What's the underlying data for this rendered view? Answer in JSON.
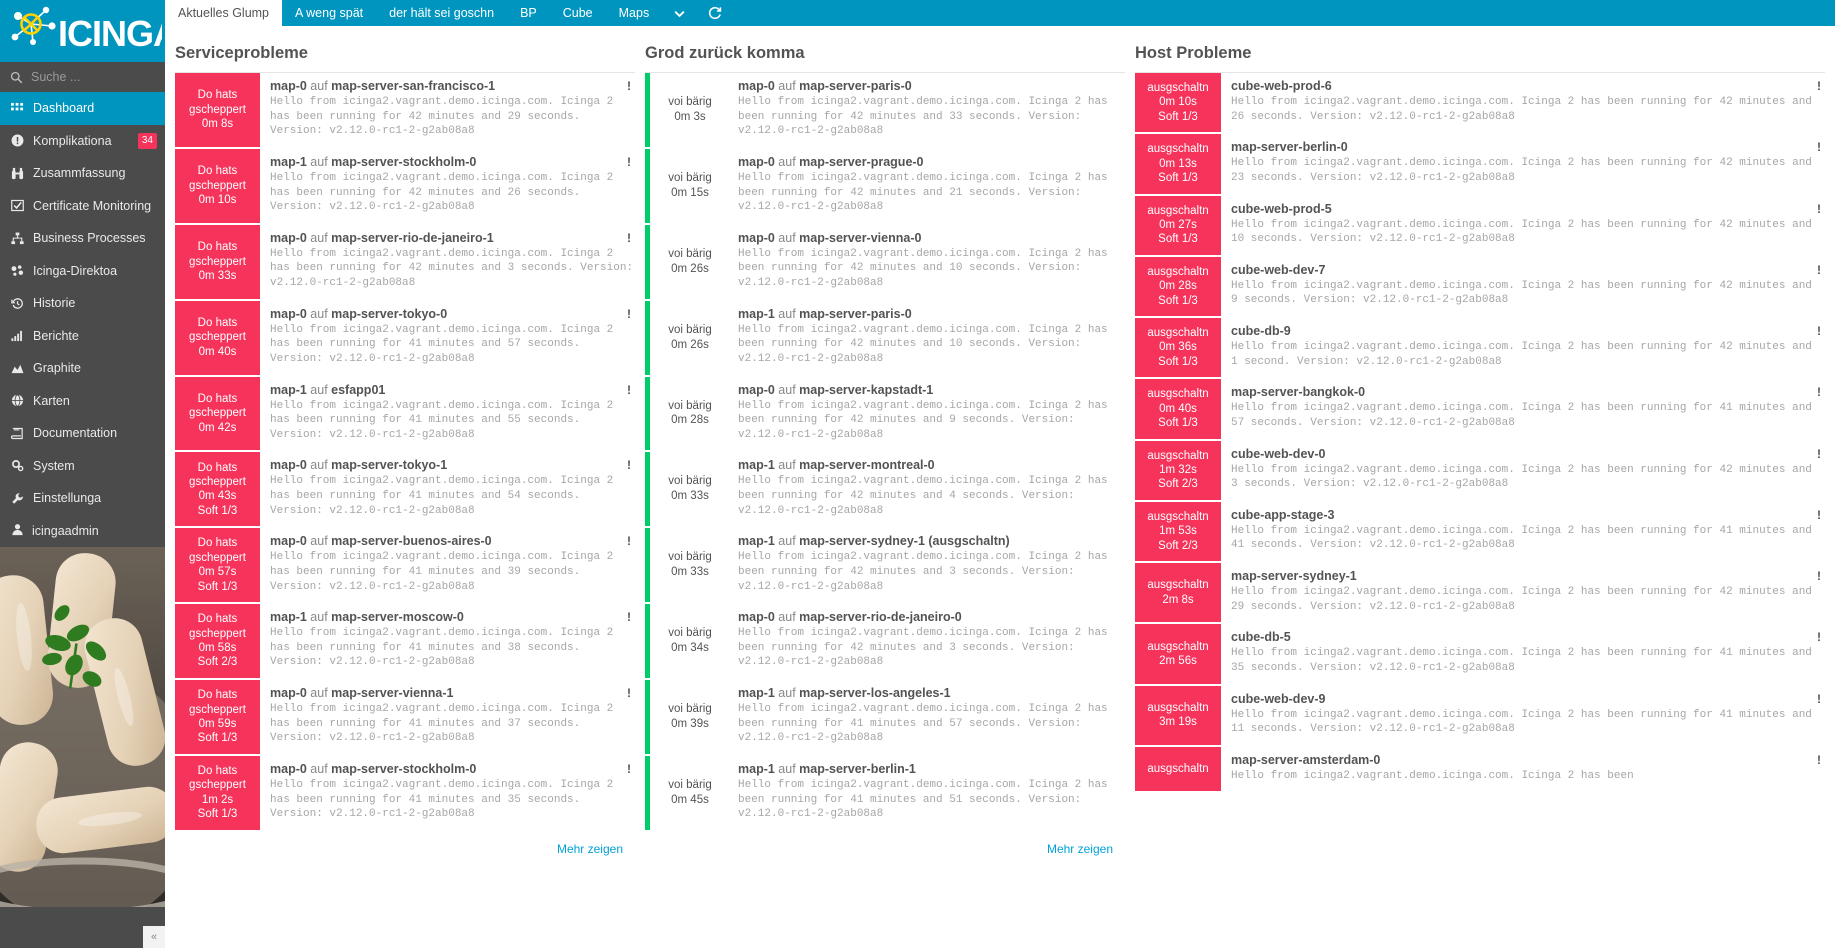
{
  "brand": {
    "name": "ICINGA",
    "logo_icon": "icinga-pretzel-logo"
  },
  "colors": {
    "accent": "#0095bf",
    "critical": "#f5335b",
    "ok": "#00cc6a",
    "link": "#00a2d8",
    "sidebar": "#4b4b4b"
  },
  "search": {
    "placeholder": "Suche ...",
    "value": "",
    "icon": "search-icon"
  },
  "sidebar": {
    "items": [
      {
        "label": "Dashboard",
        "icon": "grid-icon",
        "active": true,
        "badge": ""
      },
      {
        "label": "Komplikationa",
        "icon": "exclamation-circle-icon",
        "active": false,
        "badge": "34"
      },
      {
        "label": "Zusammfassung",
        "icon": "binoculars-icon",
        "active": false,
        "badge": ""
      },
      {
        "label": "Certificate Monitoring",
        "icon": "certificate-check-icon",
        "active": false,
        "badge": ""
      },
      {
        "label": "Business Processes",
        "icon": "sitemap-icon",
        "active": false,
        "badge": ""
      },
      {
        "label": "Icinga-Direktoa",
        "icon": "cloud-nodes-icon",
        "active": false,
        "badge": ""
      },
      {
        "label": "Historie",
        "icon": "history-clock-icon",
        "active": false,
        "badge": ""
      },
      {
        "label": "Berichte",
        "icon": "bar-chart-icon",
        "active": false,
        "badge": ""
      },
      {
        "label": "Graphite",
        "icon": "area-chart-icon",
        "active": false,
        "badge": ""
      },
      {
        "label": "Karten",
        "icon": "globe-icon",
        "active": false,
        "badge": ""
      },
      {
        "label": "Documentation",
        "icon": "book-icon",
        "active": false,
        "badge": ""
      },
      {
        "label": "System",
        "icon": "cogs-icon",
        "active": false,
        "badge": ""
      },
      {
        "label": "Einstellunga",
        "icon": "wrench-icon",
        "active": false,
        "badge": ""
      }
    ],
    "user": {
      "label": "icingaadmin",
      "icon": "user-icon"
    },
    "collapse": {
      "icon": "chevron-left-icon",
      "label": "«"
    }
  },
  "tabs": [
    {
      "label": "Aktuelles Glump",
      "active": true
    },
    {
      "label": "A weng spät",
      "active": false
    },
    {
      "label": "der hält sei goschn",
      "active": false
    },
    {
      "label": "BP",
      "active": false
    },
    {
      "label": "Cube",
      "active": false
    },
    {
      "label": "Maps",
      "active": false
    }
  ],
  "tab_icons": [
    {
      "name": "chevron-down-icon",
      "glyph": "⌄"
    },
    {
      "name": "refresh-icon",
      "glyph": "⟳"
    }
  ],
  "columns": {
    "service_problems": {
      "title": "Serviceprobleme",
      "more_label": "Mehr zeigen",
      "rows": [
        {
          "state": "Do hats gscheppert",
          "duration": "0m 8s",
          "attempt": "",
          "service": "map-0",
          "conj": "auf",
          "host": "map-server-san-francisco-1",
          "message": "Hello from icinga2.vagrant.demo.icinga.com. Icinga 2 has been running for 42 minutes and 29 seconds. Version: v2.12.0-rc1-2-g2ab08a8",
          "icon": "exclamation-icon"
        },
        {
          "state": "Do hats gscheppert",
          "duration": "0m 10s",
          "attempt": "",
          "service": "map-1",
          "conj": "auf",
          "host": "map-server-stockholm-0",
          "message": "Hello from icinga2.vagrant.demo.icinga.com. Icinga 2 has been running for 42 minutes and 26 seconds. Version: v2.12.0-rc1-2-g2ab08a8",
          "icon": "exclamation-icon"
        },
        {
          "state": "Do hats gscheppert",
          "duration": "0m 33s",
          "attempt": "",
          "service": "map-0",
          "conj": "auf",
          "host": "map-server-rio-de-janeiro-1",
          "message": "Hello from icinga2.vagrant.demo.icinga.com. Icinga 2 has been running for 42 minutes and 3 seconds. Version: v2.12.0-rc1-2-g2ab08a8",
          "icon": "exclamation-icon"
        },
        {
          "state": "Do hats gscheppert",
          "duration": "0m 40s",
          "attempt": "",
          "service": "map-0",
          "conj": "auf",
          "host": "map-server-tokyo-0",
          "message": "Hello from icinga2.vagrant.demo.icinga.com. Icinga 2 has been running for 41 minutes and 57 seconds. Version: v2.12.0-rc1-2-g2ab08a8",
          "icon": "exclamation-icon"
        },
        {
          "state": "Do hats gscheppert",
          "duration": "0m 42s",
          "attempt": "",
          "service": "map-1",
          "conj": "auf",
          "host": "esfapp01",
          "message": "Hello from icinga2.vagrant.demo.icinga.com. Icinga 2 has been running for 41 minutes and 55 seconds. Version: v2.12.0-rc1-2-g2ab08a8",
          "icon": "exclamation-icon"
        },
        {
          "state": "Do hats gscheppert",
          "duration": "0m 43s",
          "attempt": "Soft 1/3",
          "service": "map-0",
          "conj": "auf",
          "host": "map-server-tokyo-1",
          "message": "Hello from icinga2.vagrant.demo.icinga.com. Icinga 2 has been running for 41 minutes and 54 seconds. Version: v2.12.0-rc1-2-g2ab08a8",
          "icon": "exclamation-icon"
        },
        {
          "state": "Do hats gscheppert",
          "duration": "0m 57s",
          "attempt": "Soft 1/3",
          "service": "map-0",
          "conj": "auf",
          "host": "map-server-buenos-aires-0",
          "message": "Hello from icinga2.vagrant.demo.icinga.com. Icinga 2 has been running for 41 minutes and 39 seconds. Version: v2.12.0-rc1-2-g2ab08a8",
          "icon": "exclamation-icon"
        },
        {
          "state": "Do hats gscheppert",
          "duration": "0m 58s",
          "attempt": "Soft 2/3",
          "service": "map-1",
          "conj": "auf",
          "host": "map-server-moscow-0",
          "message": "Hello from icinga2.vagrant.demo.icinga.com. Icinga 2 has been running for 41 minutes and 38 seconds. Version: v2.12.0-rc1-2-g2ab08a8",
          "icon": "exclamation-icon"
        },
        {
          "state": "Do hats gscheppert",
          "duration": "0m 59s",
          "attempt": "Soft 1/3",
          "service": "map-0",
          "conj": "auf",
          "host": "map-server-vienna-1",
          "message": "Hello from icinga2.vagrant.demo.icinga.com. Icinga 2 has been running for 41 minutes and 37 seconds. Version: v2.12.0-rc1-2-g2ab08a8",
          "icon": "exclamation-icon"
        },
        {
          "state": "Do hats gscheppert",
          "duration": "1m 2s",
          "attempt": "Soft 1/3",
          "service": "map-0",
          "conj": "auf",
          "host": "map-server-stockholm-0",
          "message": "Hello from icinga2.vagrant.demo.icinga.com. Icinga 2 has been running for 41 minutes and 35 seconds. Version: v2.12.0-rc1-2-g2ab08a8",
          "icon": "exclamation-icon"
        }
      ]
    },
    "recent_recoveries": {
      "title": "Grod zurück komma",
      "more_label": "Mehr zeigen",
      "rows": [
        {
          "state": "voi bärig",
          "duration": "0m 3s",
          "service": "map-0",
          "conj": "auf",
          "host": "map-server-paris-0",
          "message": "Hello from icinga2.vagrant.demo.icinga.com. Icinga 2 has been running for 42 minutes and 33 seconds. Version: v2.12.0-rc1-2-g2ab08a8"
        },
        {
          "state": "voi bärig",
          "duration": "0m 15s",
          "service": "map-0",
          "conj": "auf",
          "host": "map-server-prague-0",
          "message": "Hello from icinga2.vagrant.demo.icinga.com. Icinga 2 has been running for 42 minutes and 21 seconds. Version: v2.12.0-rc1-2-g2ab08a8"
        },
        {
          "state": "voi bärig",
          "duration": "0m 26s",
          "service": "map-0",
          "conj": "auf",
          "host": "map-server-vienna-0",
          "message": "Hello from icinga2.vagrant.demo.icinga.com. Icinga 2 has been running for 42 minutes and 10 seconds. Version: v2.12.0-rc1-2-g2ab08a8"
        },
        {
          "state": "voi bärig",
          "duration": "0m 26s",
          "service": "map-1",
          "conj": "auf",
          "host": "map-server-paris-0",
          "message": "Hello from icinga2.vagrant.demo.icinga.com. Icinga 2 has been running for 42 minutes and 10 seconds. Version: v2.12.0-rc1-2-g2ab08a8"
        },
        {
          "state": "voi bärig",
          "duration": "0m 28s",
          "service": "map-0",
          "conj": "auf",
          "host": "map-server-kapstadt-1",
          "message": "Hello from icinga2.vagrant.demo.icinga.com. Icinga 2 has been running for 42 minutes and 9 seconds. Version: v2.12.0-rc1-2-g2ab08a8"
        },
        {
          "state": "voi bärig",
          "duration": "0m 33s",
          "service": "map-1",
          "conj": "auf",
          "host": "map-server-montreal-0",
          "message": "Hello from icinga2.vagrant.demo.icinga.com. Icinga 2 has been running for 42 minutes and 4 seconds. Version: v2.12.0-rc1-2-g2ab08a8"
        },
        {
          "state": "voi bärig",
          "duration": "0m 33s",
          "service": "map-1",
          "conj": "auf",
          "host": "map-server-sydney-1 (ausgschaltn)",
          "message": "Hello from icinga2.vagrant.demo.icinga.com. Icinga 2 has been running for 42 minutes and 3 seconds. Version: v2.12.0-rc1-2-g2ab08a8"
        },
        {
          "state": "voi bärig",
          "duration": "0m 34s",
          "service": "map-0",
          "conj": "auf",
          "host": "map-server-rio-de-janeiro-0",
          "message": "Hello from icinga2.vagrant.demo.icinga.com. Icinga 2 has been running for 42 minutes and 3 seconds. Version: v2.12.0-rc1-2-g2ab08a8"
        },
        {
          "state": "voi bärig",
          "duration": "0m 39s",
          "service": "map-1",
          "conj": "auf",
          "host": "map-server-los-angeles-1",
          "message": "Hello from icinga2.vagrant.demo.icinga.com. Icinga 2 has been running for 41 minutes and 57 seconds. Version: v2.12.0-rc1-2-g2ab08a8"
        },
        {
          "state": "voi bärig",
          "duration": "0m 45s",
          "service": "map-1",
          "conj": "auf",
          "host": "map-server-berlin-1",
          "message": "Hello from icinga2.vagrant.demo.icinga.com. Icinga 2 has been running for 41 minutes and 51 seconds. Version: v2.12.0-rc1-2-g2ab08a8"
        }
      ]
    },
    "host_problems": {
      "title": "Host Probleme",
      "rows": [
        {
          "state": "ausgschaltn",
          "duration": "0m 10s",
          "attempt": "Soft 1/3",
          "host": "cube-web-prod-6",
          "message": "Hello from icinga2.vagrant.demo.icinga.com. Icinga 2 has been running for 42 minutes and 26 seconds. Version: v2.12.0-rc1-2-g2ab08a8",
          "icon": "exclamation-icon"
        },
        {
          "state": "ausgschaltn",
          "duration": "0m 13s",
          "attempt": "Soft 1/3",
          "host": "map-server-berlin-0",
          "message": "Hello from icinga2.vagrant.demo.icinga.com. Icinga 2 has been running for 42 minutes and 23 seconds. Version: v2.12.0-rc1-2-g2ab08a8",
          "icon": "exclamation-icon"
        },
        {
          "state": "ausgschaltn",
          "duration": "0m 27s",
          "attempt": "Soft 1/3",
          "host": "cube-web-prod-5",
          "message": "Hello from icinga2.vagrant.demo.icinga.com. Icinga 2 has been running for 42 minutes and 10 seconds. Version: v2.12.0-rc1-2-g2ab08a8",
          "icon": "exclamation-icon"
        },
        {
          "state": "ausgschaltn",
          "duration": "0m 28s",
          "attempt": "Soft 1/3",
          "host": "cube-web-dev-7",
          "message": "Hello from icinga2.vagrant.demo.icinga.com. Icinga 2 has been running for 42 minutes and 9 seconds. Version: v2.12.0-rc1-2-g2ab08a8",
          "icon": "exclamation-icon"
        },
        {
          "state": "ausgschaltn",
          "duration": "0m 36s",
          "attempt": "Soft 1/3",
          "host": "cube-db-9",
          "message": "Hello from icinga2.vagrant.demo.icinga.com. Icinga 2 has been running for 42 minutes and 1 second. Version: v2.12.0-rc1-2-g2ab08a8",
          "icon": "exclamation-icon"
        },
        {
          "state": "ausgschaltn",
          "duration": "0m 40s",
          "attempt": "Soft 1/3",
          "host": "map-server-bangkok-0",
          "message": "Hello from icinga2.vagrant.demo.icinga.com. Icinga 2 has been running for 41 minutes and 57 seconds. Version: v2.12.0-rc1-2-g2ab08a8",
          "icon": "exclamation-icon"
        },
        {
          "state": "ausgschaltn",
          "duration": "1m 32s",
          "attempt": "Soft 2/3",
          "host": "cube-web-dev-0",
          "message": "Hello from icinga2.vagrant.demo.icinga.com. Icinga 2 has been running for 42 minutes and 3 seconds. Version: v2.12.0-rc1-2-g2ab08a8",
          "icon": "exclamation-icon"
        },
        {
          "state": "ausgschaltn",
          "duration": "1m 53s",
          "attempt": "Soft 2/3",
          "host": "cube-app-stage-3",
          "message": "Hello from icinga2.vagrant.demo.icinga.com. Icinga 2 has been running for 41 minutes and 41 seconds. Version: v2.12.0-rc1-2-g2ab08a8",
          "icon": "exclamation-icon"
        },
        {
          "state": "ausgschaltn",
          "duration": "2m 8s",
          "attempt": "",
          "host": "map-server-sydney-1",
          "message": "Hello from icinga2.vagrant.demo.icinga.com. Icinga 2 has been running for 42 minutes and 29 seconds. Version: v2.12.0-rc1-2-g2ab08a8",
          "icon": "exclamation-icon"
        },
        {
          "state": "ausgschaltn",
          "duration": "2m 56s",
          "attempt": "",
          "host": "cube-db-5",
          "message": "Hello from icinga2.vagrant.demo.icinga.com. Icinga 2 has been running for 41 minutes and 35 seconds. Version: v2.12.0-rc1-2-g2ab08a8",
          "icon": "exclamation-icon"
        },
        {
          "state": "ausgschaltn",
          "duration": "3m 19s",
          "attempt": "",
          "host": "cube-web-dev-9",
          "message": "Hello from icinga2.vagrant.demo.icinga.com. Icinga 2 has been running for 41 minutes and 11 seconds. Version: v2.12.0-rc1-2-g2ab08a8",
          "icon": "exclamation-icon"
        },
        {
          "state": "ausgschaltn",
          "duration": "",
          "attempt": "",
          "host": "map-server-amsterdam-0",
          "message": "Hello from icinga2.vagrant.demo.icinga.com. Icinga 2 has been",
          "icon": "exclamation-icon"
        }
      ]
    }
  }
}
